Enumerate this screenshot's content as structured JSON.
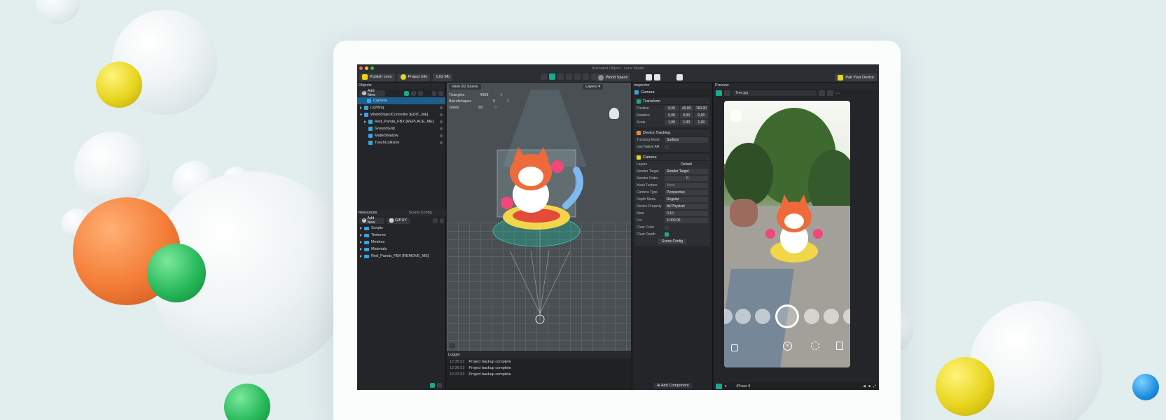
{
  "window": {
    "title": "Animated Object - Lens Studio"
  },
  "toolbar": {
    "publish_label": "Publish Lens",
    "project_info_label": "Project Info",
    "size_label": "1.62 Mb",
    "world_space_label": "World Space",
    "pair_device_label": "Pair Your Device"
  },
  "objects_panel": {
    "title": "Objects",
    "add_new_label": "Add New",
    "items": [
      {
        "label": "Camera",
        "selected": true
      },
      {
        "label": "Lighting"
      },
      {
        "label": "WorldObjectController [EDIT_ME]"
      },
      {
        "label": "Red_Panda_FBX [REPLACE_ME]"
      },
      {
        "label": "GroundGrid"
      },
      {
        "label": "MatteShadow"
      },
      {
        "label": "TouchCollision"
      }
    ]
  },
  "resources_panel": {
    "tab_resources": "Resources",
    "tab_scene_config": "Scene Config",
    "add_new_label": "Add New",
    "giphy_label": "GIPHY",
    "items": [
      {
        "label": "Scripts"
      },
      {
        "label": "Textures"
      },
      {
        "label": "Meshes"
      },
      {
        "label": "Materials"
      },
      {
        "label": "Red_Panda_FBX [REMOVE_ME]"
      }
    ]
  },
  "viewport": {
    "view_2d_label": "View 2D Scene",
    "layers_label": "Layers",
    "stats": [
      {
        "label": "Triangles",
        "value": "4058",
        "extra": "0"
      },
      {
        "label": "Blendshapes",
        "value": "0",
        "extra": "0"
      },
      {
        "label": "Joints",
        "value": "65",
        "extra": "0"
      }
    ]
  },
  "logger": {
    "title": "Logger",
    "entries": [
      {
        "time": "12:36:52",
        "message": "Project backup complete"
      },
      {
        "time": "12:36:53",
        "message": "Project backup complete"
      },
      {
        "time": "12:37:53",
        "message": "Project backup complete"
      }
    ]
  },
  "inspector": {
    "title": "Inspector",
    "object_name": "Camera",
    "transform": {
      "title": "Transform",
      "position": [
        "0,00",
        "40,00",
        "160,00"
      ],
      "rotation": [
        "0,00",
        "0,00",
        "0,00"
      ],
      "scale": [
        "1,00",
        "1,00",
        "1,00"
      ],
      "position_label": "Position",
      "rotation_label": "Rotation",
      "scale_label": "Scale"
    },
    "device_tracking": {
      "title": "Device Tracking",
      "tracking_mode_label": "Tracking Mode",
      "tracking_mode_value": "Surface",
      "use_native_ar_label": "Use Native AR"
    },
    "camera": {
      "title": "Camera",
      "layers_label": "Layers",
      "layers_value": "Default",
      "render_target_label": "Render Target",
      "render_target_value": "Render Target",
      "render_order_label": "Render Order",
      "render_order_value": "0",
      "mask_texture_label": "Mask Texture",
      "mask_texture_value": "None",
      "camera_type_label": "Camera Type",
      "camera_type_value": "Perspective",
      "depth_mode_label": "Depth Mode",
      "depth_mode_value": "Regular",
      "device_property_label": "Device Property",
      "device_property_value": "All Physical",
      "near_label": "Near",
      "near_value": "0,10",
      "far_label": "Far",
      "far_value": "5 000,00",
      "clear_color_label": "Clear Color",
      "clear_depth_label": "Clear Depth",
      "scene_config_label": "Scene Config"
    },
    "add_component_label": "Add Component"
  },
  "preview": {
    "title": "Preview",
    "file_label": "Tree.jpg",
    "device_label": "iPhone 8"
  },
  "colors": {
    "accent": "#19a98d",
    "selection": "#1c5f8f",
    "panel": "#232528"
  }
}
